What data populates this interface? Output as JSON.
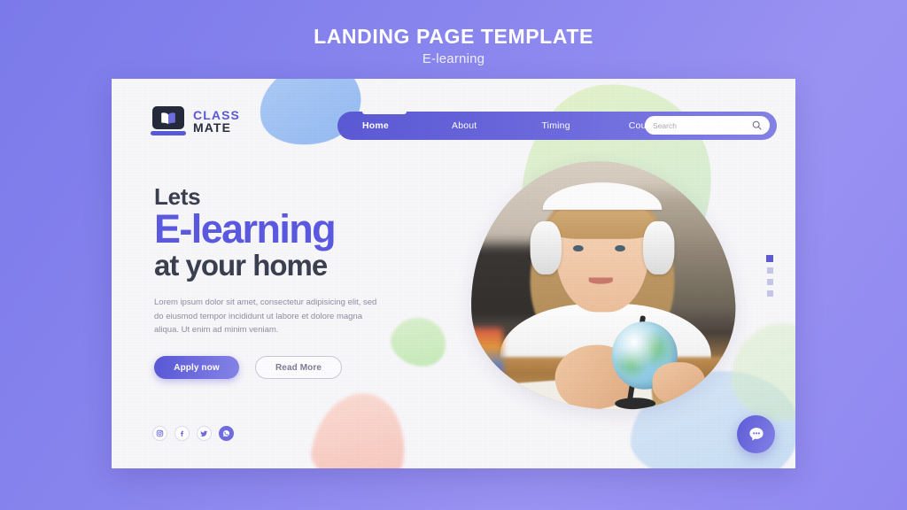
{
  "header": {
    "title": "LANDING PAGE TEMPLATE",
    "subtitle": "E-learning"
  },
  "colors": {
    "background_gradient_start": "#7b7aea",
    "background_gradient_end": "#9a92f2",
    "brand_purple": "#5a59d8",
    "nav_gradient_start": "#5b59d4",
    "nav_gradient_end": "#8482e6",
    "heading_dark": "#3b4050",
    "body_text": "#8e8ea4",
    "card_background": "#f7f6f9"
  },
  "logo": {
    "icon": "laptop-book-icon",
    "line1": "CLASS",
    "line2": "MATE"
  },
  "nav": {
    "items": [
      {
        "label": "Home",
        "active": true
      },
      {
        "label": "About",
        "active": false
      },
      {
        "label": "Timing",
        "active": false
      },
      {
        "label": "Courses",
        "active": false
      }
    ],
    "search": {
      "placeholder": "Search",
      "value": "",
      "icon": "search-icon"
    }
  },
  "hero": {
    "eyebrow": "Lets",
    "headline": "E-learning",
    "subheadline": "at your home",
    "paragraph": "Lorem ipsum dolor sit amet, consectetur adipisicing elit, sed do eiusmod tempor incididunt ut labore et dolore magna aliqua. Ut enim ad minim veniam.",
    "primary_button": "Apply now",
    "secondary_button": "Read More"
  },
  "social": [
    {
      "name": "instagram-icon"
    },
    {
      "name": "facebook-icon"
    },
    {
      "name": "twitter-icon"
    },
    {
      "name": "whatsapp-icon"
    }
  ],
  "pager": {
    "total": 4,
    "active_index": 0
  },
  "chat": {
    "icon": "chat-bubble-icon",
    "label": "Chat"
  },
  "photo": {
    "alt": "Girl wearing white headphones studying at a desk with a globe"
  }
}
